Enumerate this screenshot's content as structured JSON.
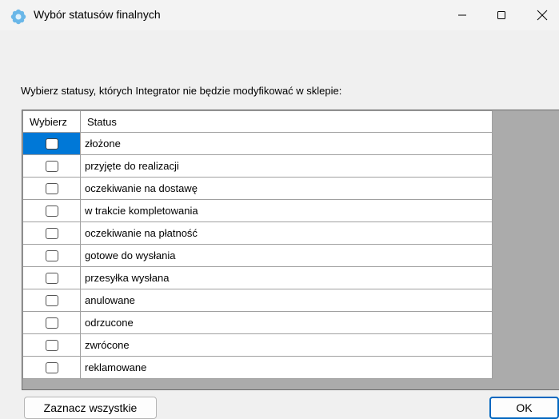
{
  "window": {
    "title": "Wybór statusów finalnych",
    "controls": {
      "minimize": "minimize",
      "maximize": "maximize",
      "close": "close"
    }
  },
  "prompt": "Wybierz statusy, których Integrator nie będzie modyfikować w sklepie:",
  "table": {
    "columns": [
      "Wybierz",
      "Status"
    ],
    "rows": [
      {
        "checked": false,
        "status": "złożone"
      },
      {
        "checked": false,
        "status": "przyjęte do realizacji"
      },
      {
        "checked": false,
        "status": "oczekiwanie na dostawę"
      },
      {
        "checked": false,
        "status": "w trakcie kompletowania"
      },
      {
        "checked": false,
        "status": "oczekiwanie na płatność"
      },
      {
        "checked": false,
        "status": "gotowe do wysłania"
      },
      {
        "checked": false,
        "status": "przesyłka wysłana"
      },
      {
        "checked": false,
        "status": "anulowane"
      },
      {
        "checked": false,
        "status": "odrzucone"
      },
      {
        "checked": false,
        "status": "zwrócone"
      },
      {
        "checked": false,
        "status": "reklamowane"
      }
    ],
    "selected_row": 0
  },
  "buttons": {
    "select_all": "Zaznacz wszystkie",
    "ok": "OK"
  },
  "colors": {
    "selection": "#0078d7",
    "grid_background": "#ababab",
    "ok_border": "#0067c0"
  },
  "icons": {
    "app": "blue-flower-icon",
    "minimize": "minimize-icon",
    "maximize": "maximize-icon",
    "close": "close-icon"
  }
}
